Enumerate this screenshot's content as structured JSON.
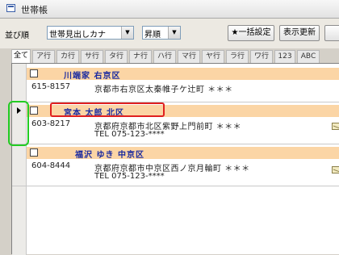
{
  "window": {
    "title": "世帯帳",
    "icon": "app-window-icon"
  },
  "toolbar": {
    "sort_label": "並び順",
    "sort_field": "世帯見出しカナ",
    "sort_order": "昇順",
    "bulk_button": "★一括設定",
    "refresh_button": "表示更新"
  },
  "tabs": [
    "全て",
    "ア行",
    "カ行",
    "サ行",
    "タ行",
    "ナ行",
    "ハ行",
    "マ行",
    "ヤ行",
    "ラ行",
    "ワ行",
    "123",
    "ABC"
  ],
  "records": [
    {
      "name": "川端家 右京区",
      "postal": "615-8157",
      "address": "京都市右京区太秦帷子ケ辻町 ＊＊＊",
      "tel": ""
    },
    {
      "name": "宮本 太郎 北区",
      "postal": "603-8217",
      "address": "京都府京都市北区紫野上門前町 ＊＊＊",
      "tel": "TEL 075-123-****"
    },
    {
      "name": "福沢 ゆき 中京区",
      "postal": "604-8444",
      "address": "京都府京都市中京区西ノ京月輪町 ＊＊＊",
      "tel": "TEL 075-123-****"
    }
  ],
  "colors": {
    "record_header": "#fbd5a5",
    "name_text": "#1a2aa0",
    "highlight_red": "#e02020",
    "highlight_green": "#22cc22"
  }
}
